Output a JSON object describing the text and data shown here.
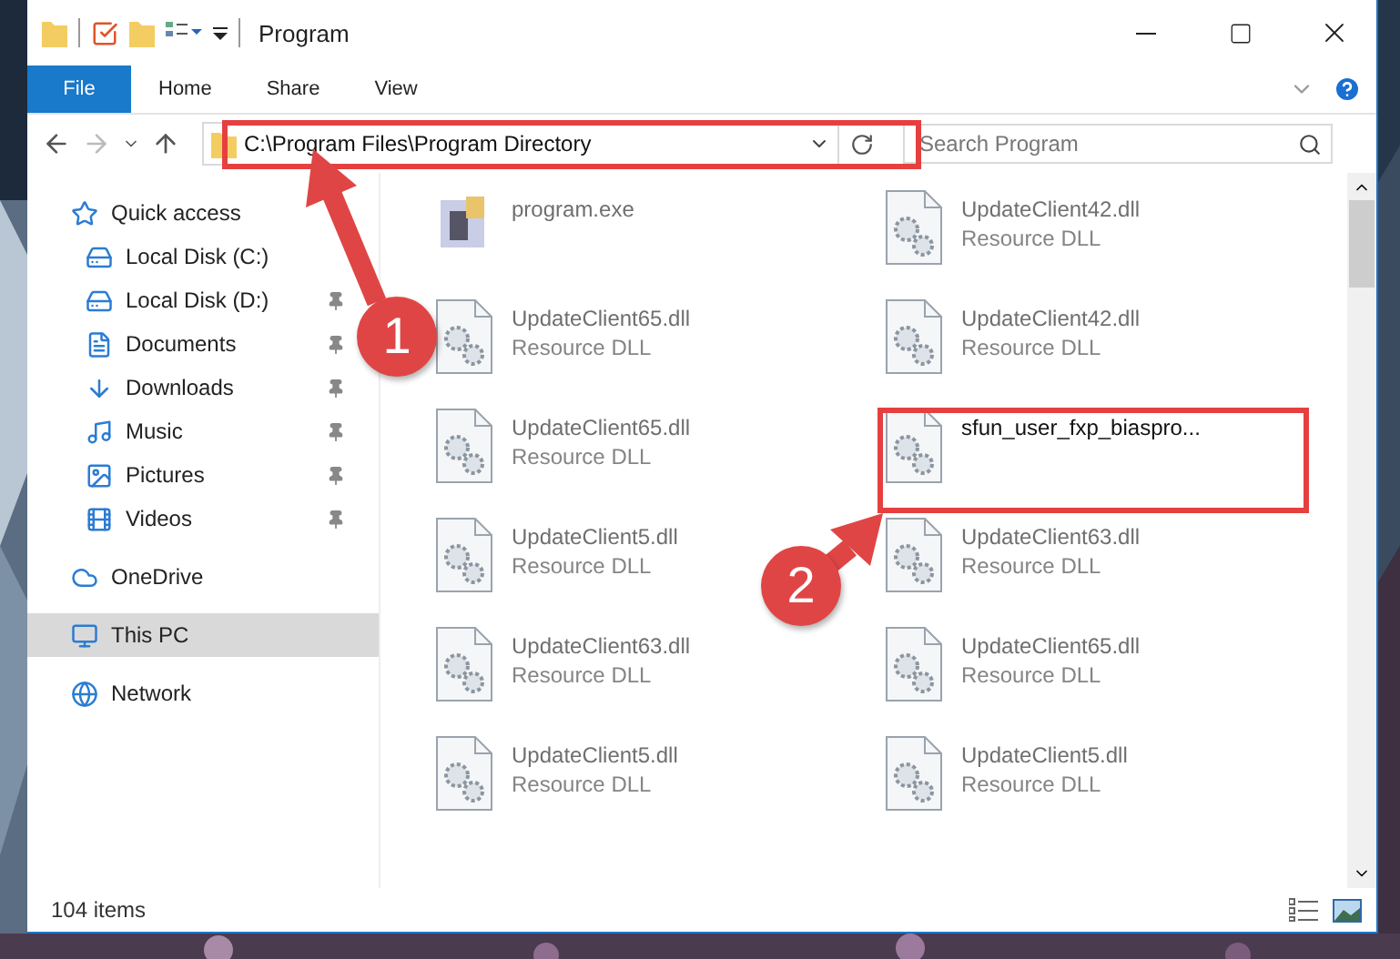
{
  "window": {
    "title": "Program"
  },
  "ribbon_tabs": [
    {
      "label": "File",
      "kind": "file"
    },
    {
      "label": "Home",
      "kind": "tab"
    },
    {
      "label": "Share",
      "kind": "tab"
    },
    {
      "label": "View",
      "kind": "tab"
    }
  ],
  "address_bar": {
    "path": "C:\\Program Files\\Program Directory"
  },
  "search": {
    "placeholder": "Search Program"
  },
  "sidebar": [
    {
      "label": "Quick access",
      "selected": false,
      "children": [
        {
          "label": "Local Disk (C:)",
          "pinned": false,
          "selected": false
        },
        {
          "label": "Local Disk (D:)",
          "pinned": true,
          "selected": false
        },
        {
          "label": "Documents",
          "pinned": true,
          "selected": false
        },
        {
          "label": "Downloads",
          "pinned": true,
          "selected": false
        },
        {
          "label": "Music",
          "pinned": true,
          "selected": false
        },
        {
          "label": "Pictures",
          "pinned": true,
          "selected": false
        },
        {
          "label": "Videos",
          "pinned": true,
          "selected": false
        }
      ]
    },
    {
      "label": "OneDrive",
      "selected": false
    },
    {
      "label": "This PC",
      "selected": true
    },
    {
      "label": "Network",
      "selected": false
    }
  ],
  "files": [
    {
      "name": "program.exe",
      "kind": "exe",
      "faded": true
    },
    {
      "name": "UpdateClient42.dll",
      "type": "Resource DLL",
      "kind": "dll",
      "faded": true
    },
    {
      "name": "UpdateClient65.dll",
      "type": "Resource DLL",
      "kind": "dll",
      "faded": true
    },
    {
      "name": "UpdateClient42.dll",
      "type": "Resource DLL",
      "kind": "dll",
      "faded": true
    },
    {
      "name": "UpdateClient65.dll",
      "type": "Resource DLL",
      "kind": "dll",
      "faded": true
    },
    {
      "name": "sfun_user_fxp_biaspro...",
      "kind": "dll",
      "faded": false
    },
    {
      "name": "UpdateClient5.dll",
      "type": "Resource DLL",
      "kind": "dll",
      "faded": true
    },
    {
      "name": "UpdateClient63.dll",
      "type": "Resource DLL",
      "kind": "dll",
      "faded": true
    },
    {
      "name": "UpdateClient63.dll",
      "type": "Resource DLL",
      "kind": "dll",
      "faded": true
    },
    {
      "name": "UpdateClient65.dll",
      "type": "Resource DLL",
      "kind": "dll",
      "faded": true
    },
    {
      "name": "UpdateClient5.dll",
      "type": "Resource DLL",
      "kind": "dll",
      "faded": true
    },
    {
      "name": "UpdateClient5.dll",
      "type": "Resource DLL",
      "kind": "dll",
      "faded": true
    }
  ],
  "status_bar": {
    "item_count": "104 items"
  },
  "annotations": [
    {
      "number": "1"
    },
    {
      "number": "2"
    }
  ]
}
